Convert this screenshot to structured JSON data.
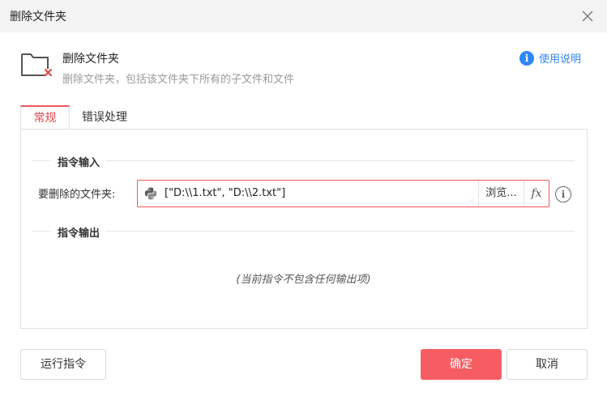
{
  "window": {
    "title": "删除文件夹",
    "close_icon": "close-icon"
  },
  "header": {
    "title": "删除文件夹",
    "description": "删除文件夹，包括该文件夹下所有的子文件和文件",
    "icon": "folder-delete-icon",
    "help_label": "使用说明",
    "help_icon_glyph": "i",
    "accent_color": "#2f86f6"
  },
  "tabs": [
    {
      "label": "常规",
      "active": true
    },
    {
      "label": "错误处理",
      "active": false
    }
  ],
  "sections": {
    "input_title": "指令输入",
    "output_title": "指令输出"
  },
  "field": {
    "label": "要删除的文件夹:",
    "value": "[\"D:\\\\1.txt\", \"D:\\\\2.txt\"]",
    "value_icon": "python-icon",
    "browse_label": "浏览...",
    "fx_label": "fx",
    "info_glyph": "i"
  },
  "output_empty_note": "(当前指令不包含任何输出项)",
  "buttons": {
    "run": "运行指令",
    "ok": "确定",
    "cancel": "取消"
  },
  "colors": {
    "primary": "#f65d63",
    "tab_active": "#e0474c",
    "link": "#2f86f6"
  }
}
